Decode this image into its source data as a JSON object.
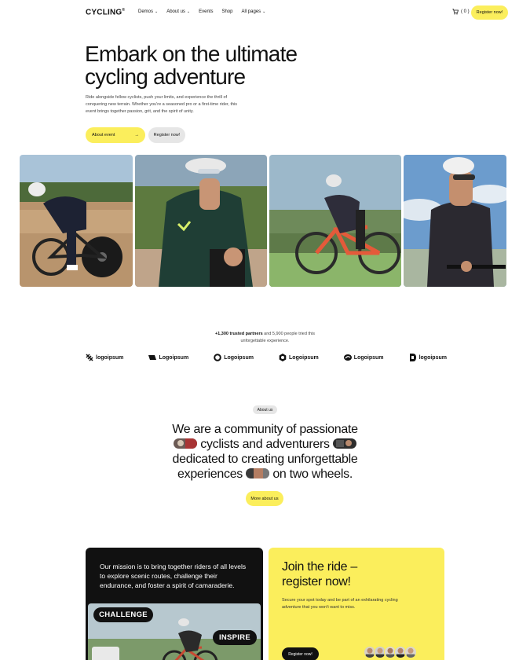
{
  "nav": {
    "logo": "CYCLING",
    "logo_mark": "®",
    "menu": [
      {
        "label": "Demos",
        "has_dropdown": true
      },
      {
        "label": "About us",
        "has_dropdown": true
      },
      {
        "label": "Events",
        "has_dropdown": false
      },
      {
        "label": "Shop",
        "has_dropdown": false
      },
      {
        "label": "All pages",
        "has_dropdown": true
      }
    ],
    "cart_count": "( 0 )",
    "cta": "Register now!"
  },
  "hero": {
    "title": "Embark on the ultimate cycling adventure",
    "description": "Ride alongside fellow cyclists, push your limits, and experience the thrill of conquering new terrain. Whether you're a seasoned pro or a first-time rider, this event brings together passion, grit, and the spirit of unity.",
    "primary_button": "About event",
    "secondary_button": "Register now!"
  },
  "trust": {
    "bold": "+1,300 trusted partners",
    "rest": " and 5,900 people tried this unforgettable experience."
  },
  "logos": [
    "logoipsum",
    "Logoipsum",
    "Logoipsum",
    "Logoipsum",
    "Logoipsum",
    "logoipsum"
  ],
  "about": {
    "badge": "About us",
    "line1": "We are a community of passionate",
    "line2": "cyclists and adventurers",
    "line3": "dedicated to creating unforgettable",
    "line4a": "experiences",
    "line4b": "on two wheels.",
    "button": "More about us"
  },
  "mission_card": {
    "text": "Our mission is to bring together riders of all levels to explore scenic routes, challenge their endurance, and foster a spirit of camaraderie.",
    "tag1": "CHALLENGE",
    "tag2": "INSPIRE"
  },
  "join_card": {
    "title": "Join the ride – register now!",
    "description": "Secure your spot today and be part of an exhilarating cycling adventure that you won't want to miss.",
    "button": "Register now!"
  },
  "colors": {
    "accent": "#fbee5c",
    "dark": "#111111",
    "muted": "#e6e6e6"
  }
}
